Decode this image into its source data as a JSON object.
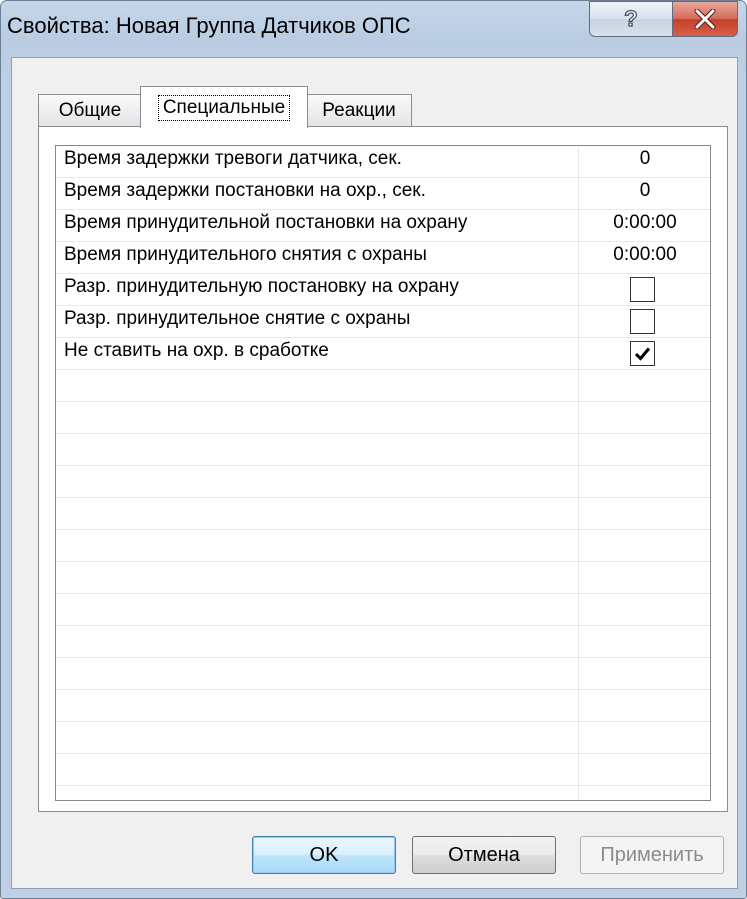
{
  "window": {
    "title": "Свойства: Новая Группа Датчиков ОПС",
    "help_icon": "help-icon",
    "close_icon": "close-icon"
  },
  "tabs": [
    {
      "label": "Общие",
      "active": false
    },
    {
      "label": "Специальные",
      "active": true
    },
    {
      "label": "Реакции",
      "active": false
    }
  ],
  "properties": [
    {
      "name": "Время задержки тревоги датчика, сек.",
      "value": "0"
    },
    {
      "name": "Время задержки постановки на охр., сек.",
      "value": "0"
    },
    {
      "name": "Время принудительной постановки на охрану",
      "value": "0:00:00"
    },
    {
      "name": "Время принудительного снятия с охраны",
      "value": "0:00:00"
    },
    {
      "name": "Разр. принудительную постановку на охрану",
      "checked": false
    },
    {
      "name": "Разр. принудительное снятие с охраны",
      "checked": false
    },
    {
      "name": "Не ставить на охр. в сработке",
      "checked": true
    }
  ],
  "buttons": {
    "ok": "OK",
    "cancel": "Отмена",
    "apply": "Применить",
    "apply_enabled": false
  },
  "colors": {
    "title_bar": "#c6d6e8",
    "close_button": "#c3412a",
    "ok_button_border": "#3c7fb1"
  }
}
